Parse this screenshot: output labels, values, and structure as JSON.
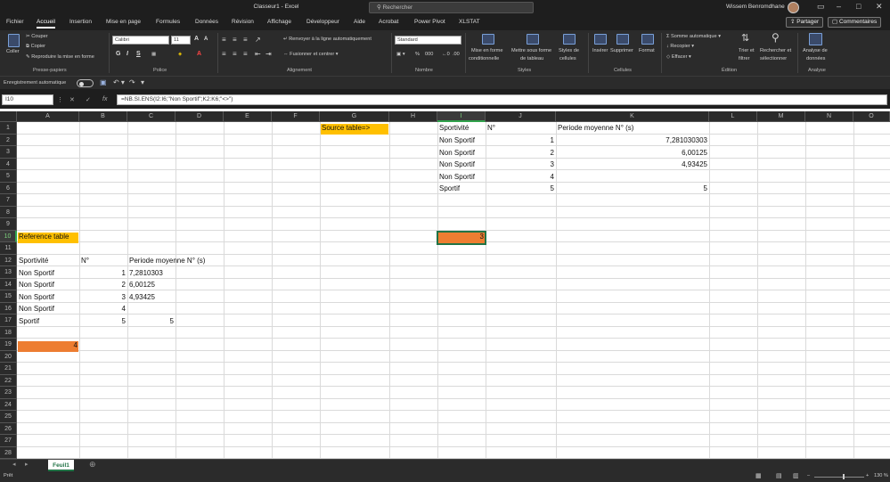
{
  "window": {
    "title": "Classeur1 - Excel",
    "search_placeholder": "Rechercher",
    "user": "Wissem Benromdhane"
  },
  "menu": {
    "tabs": [
      "Fichier",
      "Accueil",
      "Insertion",
      "Mise en page",
      "Formules",
      "Données",
      "Révision",
      "Affichage",
      "Développeur",
      "Aide",
      "Acrobat",
      "Power Pivot",
      "XLSTAT"
    ],
    "share": "Partager",
    "comments": "Commentaires"
  },
  "ribbon": {
    "paste": "Coller",
    "cut": "Couper",
    "copy": "Copier",
    "format_painter": "Reproduire la mise en forme",
    "font_name": "Calibri",
    "font_size": "11",
    "wrap_text": "Renvoyer à la ligne automatiquement",
    "merge_center": "Fusionner et centrer",
    "number_format": "Standard",
    "cond_format_1": "Mise en forme",
    "cond_format_2": "conditionnelle",
    "format_table_1": "Mettre sous forme",
    "format_table_2": "de tableau",
    "cell_styles_1": "Styles de",
    "cell_styles_2": "cellules",
    "insert": "Insérer",
    "delete": "Supprimer",
    "format": "Format",
    "autosum": "Somme automatique",
    "fill": "Recopier",
    "clear": "Effacer",
    "sort_1": "Trier et",
    "sort_2": "filtrer",
    "find_1": "Rechercher et",
    "find_2": "sélectionner",
    "analyze_1": "Analyse de",
    "analyze_2": "données",
    "groups": {
      "clipboard": "Presse-papiers",
      "font": "Police",
      "alignment": "Alignement",
      "number": "Nombre",
      "styles": "Styles",
      "cells": "Cellules",
      "editing": "Édition",
      "analysis": "Analyse"
    }
  },
  "qat": {
    "autosave": "Enregistrement automatique"
  },
  "formula_bar": {
    "name_box": "I10",
    "formula": "=NB.SI.ENS(I2:I6;\"Non Sportif\";K2:K6;\"<>\")"
  },
  "columns": [
    "A",
    "B",
    "C",
    "D",
    "E",
    "F",
    "G",
    "H",
    "I",
    "J",
    "K",
    "L",
    "M",
    "N",
    "O"
  ],
  "rows": [
    "1",
    "2",
    "3",
    "4",
    "5",
    "6",
    "7",
    "8",
    "9",
    "10",
    "11",
    "12",
    "13",
    "14",
    "15",
    "16",
    "17",
    "18",
    "19",
    "20",
    "21",
    "22",
    "23",
    "24",
    "25",
    "26",
    "27",
    "28"
  ],
  "cells": {
    "G1": "Source table=>",
    "I1": "Sportivité",
    "J1": "N°",
    "K1": "Periode moyenne N° (s)",
    "I2": "Non Sportif",
    "J2": "1",
    "K2": "7,281030303",
    "I3": "Non Sportif",
    "J3": "2",
    "K3": "6,00125",
    "I4": "Non Sportif",
    "J4": "3",
    "K4": "4,93425",
    "I5": "Non Sportif",
    "J5": "4",
    "I6": "Sportif",
    "J6": "5",
    "K6": "5",
    "I10": "3",
    "A10": "Reference table",
    "A12": "Sportivité",
    "B12": "N°",
    "C12": "Periode moyenne N° (s)",
    "A13": "Non Sportif",
    "B13": "1",
    "C13": "7,2810303",
    "A14": "Non Sportif",
    "B14": "2",
    "C14": "6,00125",
    "A15": "Non Sportif",
    "B15": "3",
    "C15": "4,93425",
    "A16": "Non Sportif",
    "B16": "4",
    "A17": "Sportif",
    "B17": "5",
    "C17": "5",
    "B19": "4"
  },
  "sheet": {
    "name": "Feuil1"
  },
  "status": {
    "ready": "Prêt",
    "zoom": "130 %"
  },
  "colors": {
    "yellow_fill": "#ffc000",
    "orange_fill": "#ed7d31",
    "excel_green": "#217346"
  }
}
